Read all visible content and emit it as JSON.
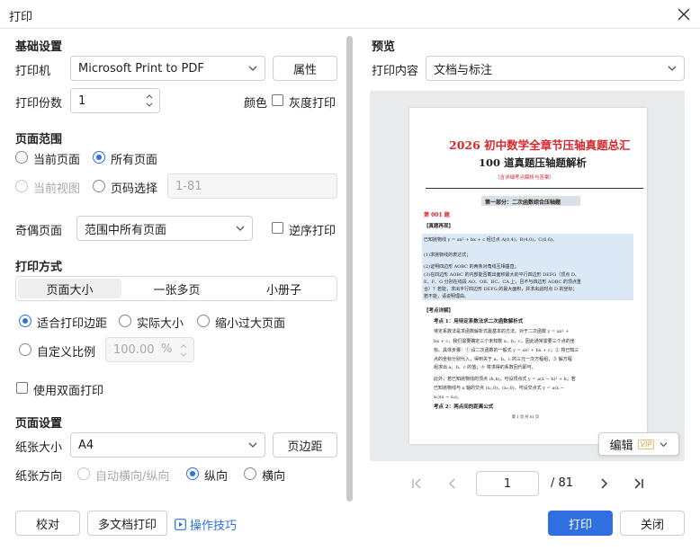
{
  "window": {
    "title": "打印"
  },
  "basic": {
    "heading": "基础设置",
    "printer_label": "打印机",
    "printer_value": "Microsoft Print to PDF",
    "properties_btn": "属性",
    "copies_label": "打印份数",
    "copies_value": "1",
    "color_label": "颜色",
    "grayscale_label": "灰度打印"
  },
  "range": {
    "heading": "页面范围",
    "current_page": "当前页面",
    "all_pages": "所有页面",
    "current_view": "当前视图",
    "page_select": "页码选择",
    "page_range_placeholder": "1-81"
  },
  "odd_even": {
    "label": "奇偶页面",
    "value": "范围中所有页面",
    "reverse_label": "逆序打印"
  },
  "mode": {
    "heading": "打印方式",
    "tabs": [
      "页面大小",
      "一张多页",
      "小册子"
    ],
    "fit_margin": "适合打印边距",
    "actual_size": "实际大小",
    "shrink_large": "缩小过大页面",
    "custom_scale": "自定义比例",
    "scale_value": "100.00",
    "scale_unit": "%",
    "duplex_label": "使用双面打印"
  },
  "page_setup": {
    "heading": "页面设置",
    "paper_label": "纸张大小",
    "paper_value": "A4",
    "margin_btn": "页边距",
    "orientation_label": "纸张方向",
    "auto_orient": "自动横向/纵向",
    "portrait": "纵向",
    "landscape": "横向"
  },
  "preview": {
    "heading": "预览",
    "content_label": "打印内容",
    "content_value": "文档与标注",
    "edit_btn": "编辑",
    "vip": "VIP",
    "page_value": "1",
    "page_total": "/ 81",
    "doc": {
      "title": "2026 初中数学全章节压轴真题总汇",
      "subtitle": "100 道真题压轴题解析",
      "note": "（含详细考点解析与答案）",
      "part": "第一部分：二次函数综合压轴题",
      "q_no": "第 001 题",
      "q_tag": "【真题再现】",
      "q1": "已知抛物线 y = ax² + bx + c 经过点 A(0,4)，B(4,0)，C(6,6)。",
      "q2": "(1)求抛物线的表达式；",
      "q3": "(2)证明四边形 AOBC 的两条对角线互相垂直；",
      "q4a": "(3)在四边形 AOBC 的内部能否截出面积最大的平行四边形 DEFG（顶点 D、",
      "q4b": "E、F、G 分别在线段 AO、OB、BC、CA 上，且不与四边形 AOBC 的顶点重",
      "q4c": "合）？若能，求出平行四边形 DEFG 的最大面积，并求出此时点 D 的坐标；",
      "q4d": "若不能，请说明理由。",
      "a_tag": "【考点详解】",
      "k1": "考点 1：用待定系数法求二次函数解析式",
      "k1a": "待定系数法是求函数解析式最基本的方法。对于二次函数 y = ax² +",
      "k1b": "bx + c，我们需要确定三个未知数 a，b，c，因此通常需要三个点的坐",
      "k1c": "标。具体步骤：① 设二次函数的一般式 y = ax² + bx + c；② 将已知三",
      "k1d": "点的坐标分别代入，得到关于 a、b、c 的三元一次方程组；③ 解方程",
      "k1e": "组求出 a、b、c 的值；④ 将求得的系数回代即可。",
      "k1f": "此外，若已知抛物线的顶点 (h,k)，可设顶点式 y = a(x − h)² + k；若",
      "k1g": "已知抛物线与 x 轴的交点 (x₁,0)，(x₂,0)，可设交点式 y = a(x −",
      "k1h": "x₁)(x − x₂)。",
      "k2": "考点 2：两点间的距离公式",
      "footer": "第 1 页 共 81 页"
    }
  },
  "footer": {
    "proofread": "校对",
    "multi_doc": "多文档打印",
    "tips": "操作技巧",
    "print": "打印",
    "close": "关闭"
  },
  "colors": {
    "accent": "#2f6fe0",
    "doc_title": "#d7262b"
  }
}
